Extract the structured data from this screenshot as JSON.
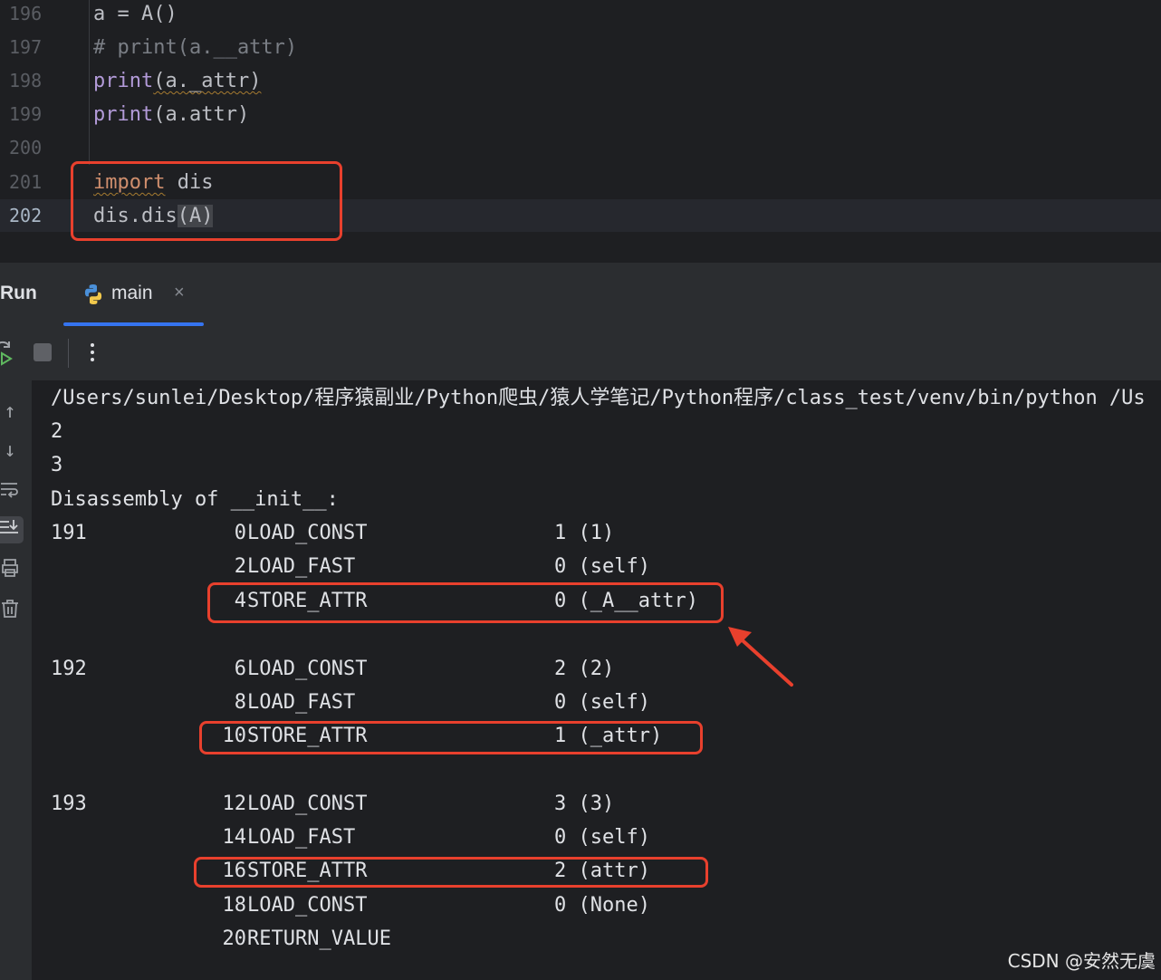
{
  "editor": {
    "lines": [
      {
        "num": "196",
        "code": "a = A()"
      },
      {
        "num": "197",
        "code": "# print(a.__attr)"
      },
      {
        "num": "198",
        "kw": "print",
        "rest": "(a._attr)"
      },
      {
        "num": "199",
        "kw": "print",
        "rest": "(a.attr)"
      },
      {
        "num": "200",
        "code": ""
      },
      {
        "num": "201",
        "kw": "import",
        "rest": " dis"
      },
      {
        "num": "202",
        "pre": "dis.dis",
        "paren": "(A)"
      }
    ]
  },
  "run_panel": {
    "title": "Run",
    "tab_label": "main",
    "tab_close": "×",
    "toolbar": {
      "rerun_icon": "rerun-icon",
      "stop_icon": "stop-icon",
      "more_icon": "more-vertical-icon"
    },
    "sidebar_icons": [
      "arrow-up-icon",
      "arrow-down-icon",
      "soft-wrap-icon",
      "scroll-to-end-icon",
      "print-icon",
      "trash-icon"
    ]
  },
  "console": {
    "command": "/Users/sunlei/Desktop/程序猿副业/Python爬虫/猿人学笔记/Python程序/class_test/venv/bin/python /Us",
    "out1": "2",
    "out2": "3",
    "header": "Disassembly of __init__:",
    "blocks": [
      {
        "line": "191",
        "rows": [
          {
            "offset": "0",
            "op": "LOAD_CONST",
            "arg": "1 (1)"
          },
          {
            "offset": "2",
            "op": "LOAD_FAST",
            "arg": "0 (self)"
          },
          {
            "offset": "4",
            "op": "STORE_ATTR",
            "arg": "0 (_A__attr)"
          }
        ]
      },
      {
        "line": "192",
        "rows": [
          {
            "offset": "6",
            "op": "LOAD_CONST",
            "arg": "2 (2)"
          },
          {
            "offset": "8",
            "op": "LOAD_FAST",
            "arg": "0 (self)"
          },
          {
            "offset": "10",
            "op": "STORE_ATTR",
            "arg": "1 (_attr)"
          }
        ]
      },
      {
        "line": "193",
        "rows": [
          {
            "offset": "12",
            "op": "LOAD_CONST",
            "arg": "3 (3)"
          },
          {
            "offset": "14",
            "op": "LOAD_FAST",
            "arg": "0 (self)"
          },
          {
            "offset": "16",
            "op": "STORE_ATTR",
            "arg": "2 (attr)"
          },
          {
            "offset": "18",
            "op": "LOAD_CONST",
            "arg": "0 (None)"
          },
          {
            "offset": "20",
            "op": "RETURN_VALUE",
            "arg": ""
          }
        ]
      }
    ]
  },
  "watermark": "CSDN @安然无虞",
  "colors": {
    "highlight_box": "#e8402d",
    "tab_accent": "#3574f0"
  }
}
